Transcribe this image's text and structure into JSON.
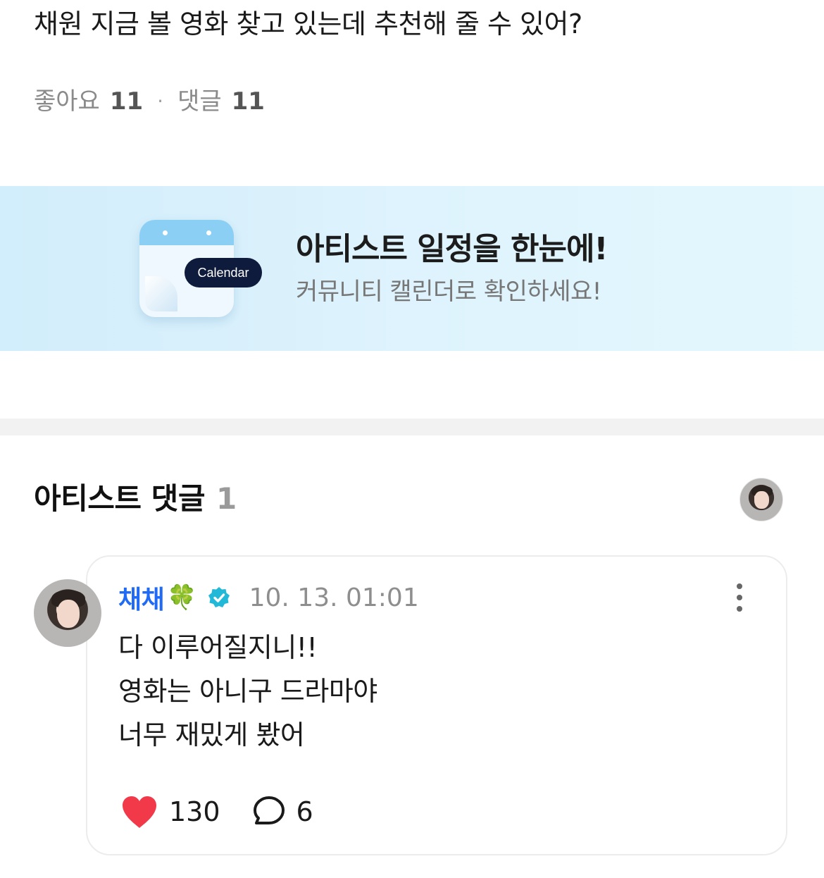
{
  "post": {
    "title": "채원 지금 볼 영화 찾고 있는데 추천해 줄 수 있어?",
    "likes_label": "좋아요",
    "likes_count": "11",
    "separator": "·",
    "comments_label": "댓글",
    "comments_count": "11"
  },
  "banner": {
    "calendar_label": "Calendar",
    "title": "아티스트 일정을 한눈에!",
    "subtitle": "커뮤니티 캘린더로 확인하세요!",
    "icon": "calendar-icon"
  },
  "artist_comments": {
    "title": "아티스트 댓글",
    "count": "1"
  },
  "comment": {
    "author": "채채",
    "author_emoji": "🍀",
    "verified_icon": "verified-badge-icon",
    "timestamp": "10. 13. 01:01",
    "lines": [
      "다 이루어질지니!!",
      "영화는 아니구 드라마야",
      "너무 재밌게 봤어"
    ],
    "like_count": "130",
    "reply_count": "6",
    "like_icon": "heart-icon",
    "reply_icon": "speech-bubble-icon",
    "more_icon": "more-vertical-icon"
  },
  "colors": {
    "author": "#1f6bf5",
    "verified": "#22b8d8",
    "heart": "#f2394a",
    "banner_bg": "#d9f0fc"
  }
}
